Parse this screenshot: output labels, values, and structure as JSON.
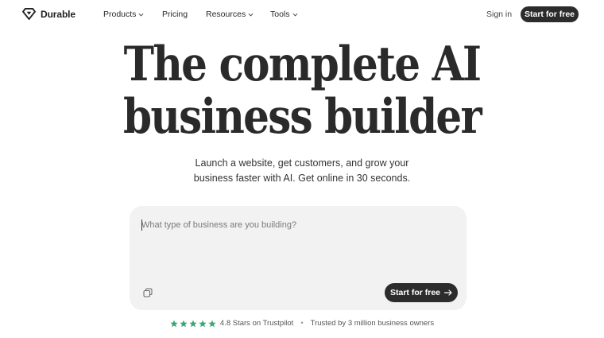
{
  "nav": {
    "brand": "Durable",
    "links": [
      {
        "label": "Products",
        "has_menu": true
      },
      {
        "label": "Pricing",
        "has_menu": false
      },
      {
        "label": "Resources",
        "has_menu": true
      },
      {
        "label": "Tools",
        "has_menu": true
      }
    ],
    "sign_in": "Sign in",
    "cta": "Start for free"
  },
  "hero": {
    "title_line1": "The complete AI",
    "title_line2": "business builder",
    "subtitle_line1": "Launch a website, get customers, and grow your",
    "subtitle_line2": "business faster with AI. Get online in 30 seconds."
  },
  "prompt": {
    "placeholder": "What type of business are you building?",
    "value": "",
    "cta": "Start for free"
  },
  "trust": {
    "rating_stars": 5,
    "rating_text": "4.8 Stars on Trustpilot",
    "separator": "•",
    "trusted_text": "Trusted by 3 million business owners"
  },
  "colors": {
    "button_bg": "#2c2c2c",
    "prompt_bg": "#f2f2f2",
    "star_green": "#3aa776"
  },
  "icons": {
    "brand_icon": "diamond-logo-icon",
    "menu_chevron": "chevron-down-icon",
    "copy": "copy-icon",
    "arrow": "arrow-right-icon",
    "star": "star-icon"
  }
}
